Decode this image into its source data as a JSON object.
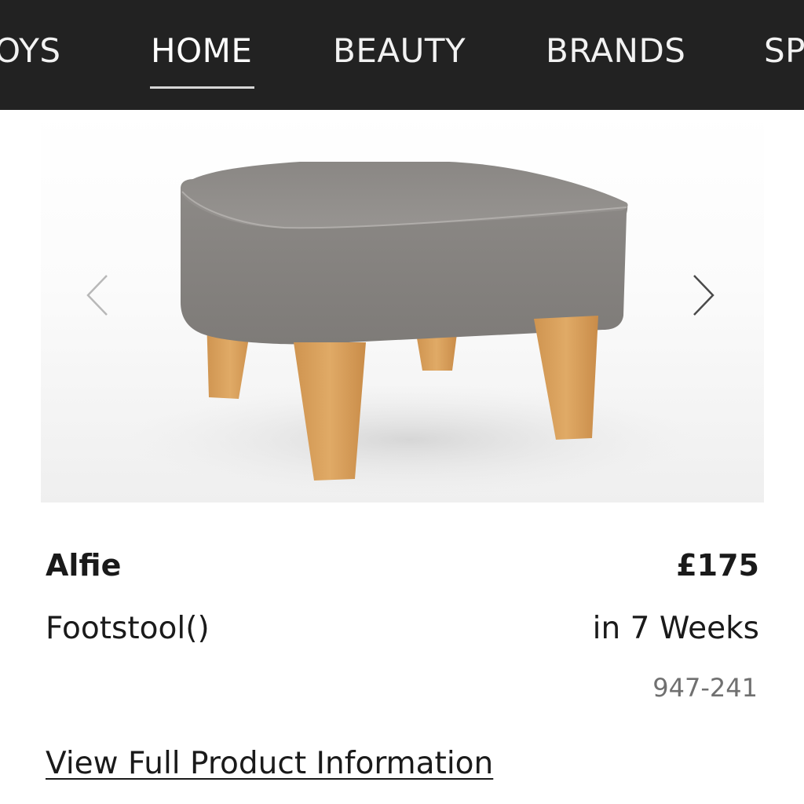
{
  "nav": {
    "items": [
      {
        "label": "OYS"
      },
      {
        "label": "HOME"
      },
      {
        "label": "BEAUTY"
      },
      {
        "label": "BRANDS"
      },
      {
        "label": "SP"
      }
    ],
    "active": "HOME"
  },
  "carousel": {
    "prev_icon": "chevron-left-icon",
    "next_icon": "chevron-right-icon"
  },
  "product": {
    "name": "Alfie",
    "type": "Footstool()",
    "price": "£175",
    "delivery": "in 7 Weeks",
    "code": "947-241",
    "image_alt": "grey footstool with light wood legs"
  },
  "links": {
    "view_full": "View Full Product Information"
  },
  "colors": {
    "nav_background": "#222222",
    "nav_text": "#f2f2f2",
    "fabric": "#8b8885",
    "wood": "#d9a05d"
  }
}
